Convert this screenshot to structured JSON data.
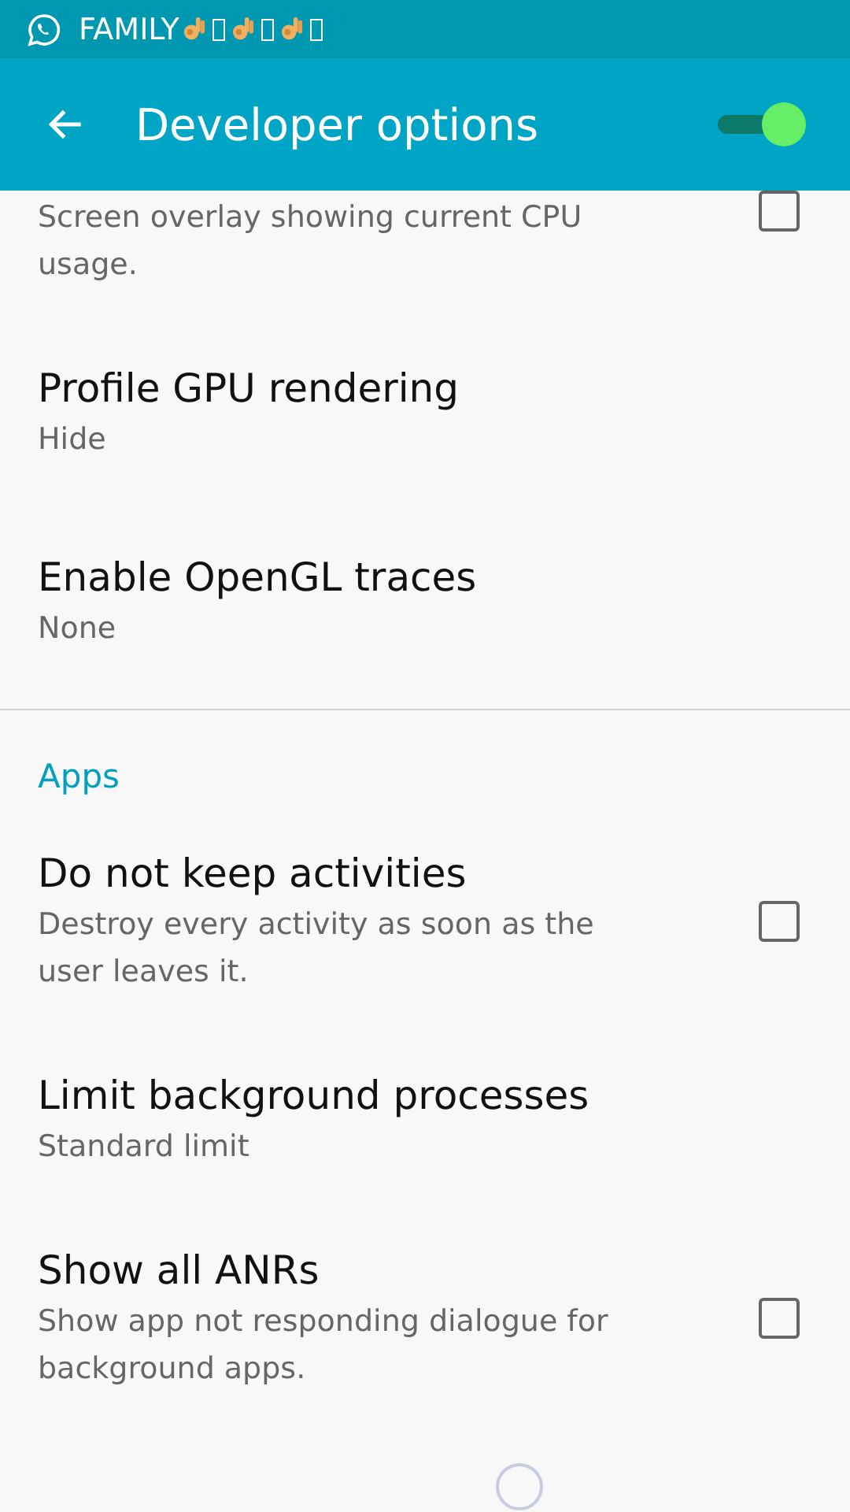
{
  "status_bar": {
    "notification": "FAMILY",
    "icons": [
      {
        "kind": "hand"
      },
      {
        "kind": "missing"
      },
      {
        "kind": "hand"
      },
      {
        "kind": "missing"
      },
      {
        "kind": "hand"
      },
      {
        "kind": "missing"
      }
    ]
  },
  "app_bar": {
    "title": "Developer options",
    "master_switch": {
      "on": true
    }
  },
  "sections": [
    {
      "items": [
        {
          "kind": "checkbox",
          "summary": "Screen overlay showing current CPU usage.",
          "checked": false
        },
        {
          "kind": "plain",
          "title": "Profile GPU rendering",
          "summary": "Hide"
        },
        {
          "kind": "plain",
          "title": "Enable OpenGL traces",
          "summary": "None"
        }
      ]
    },
    {
      "header": "Apps",
      "items": [
        {
          "kind": "checkbox",
          "title": "Do not keep activities",
          "summary": "Destroy every activity as soon as the user leaves it.",
          "checked": false
        },
        {
          "kind": "plain",
          "title": "Limit background processes",
          "summary": "Standard limit"
        },
        {
          "kind": "checkbox",
          "title": "Show all ANRs",
          "summary": "Show app not responding dialogue for background apps.",
          "checked": false
        }
      ]
    }
  ]
}
